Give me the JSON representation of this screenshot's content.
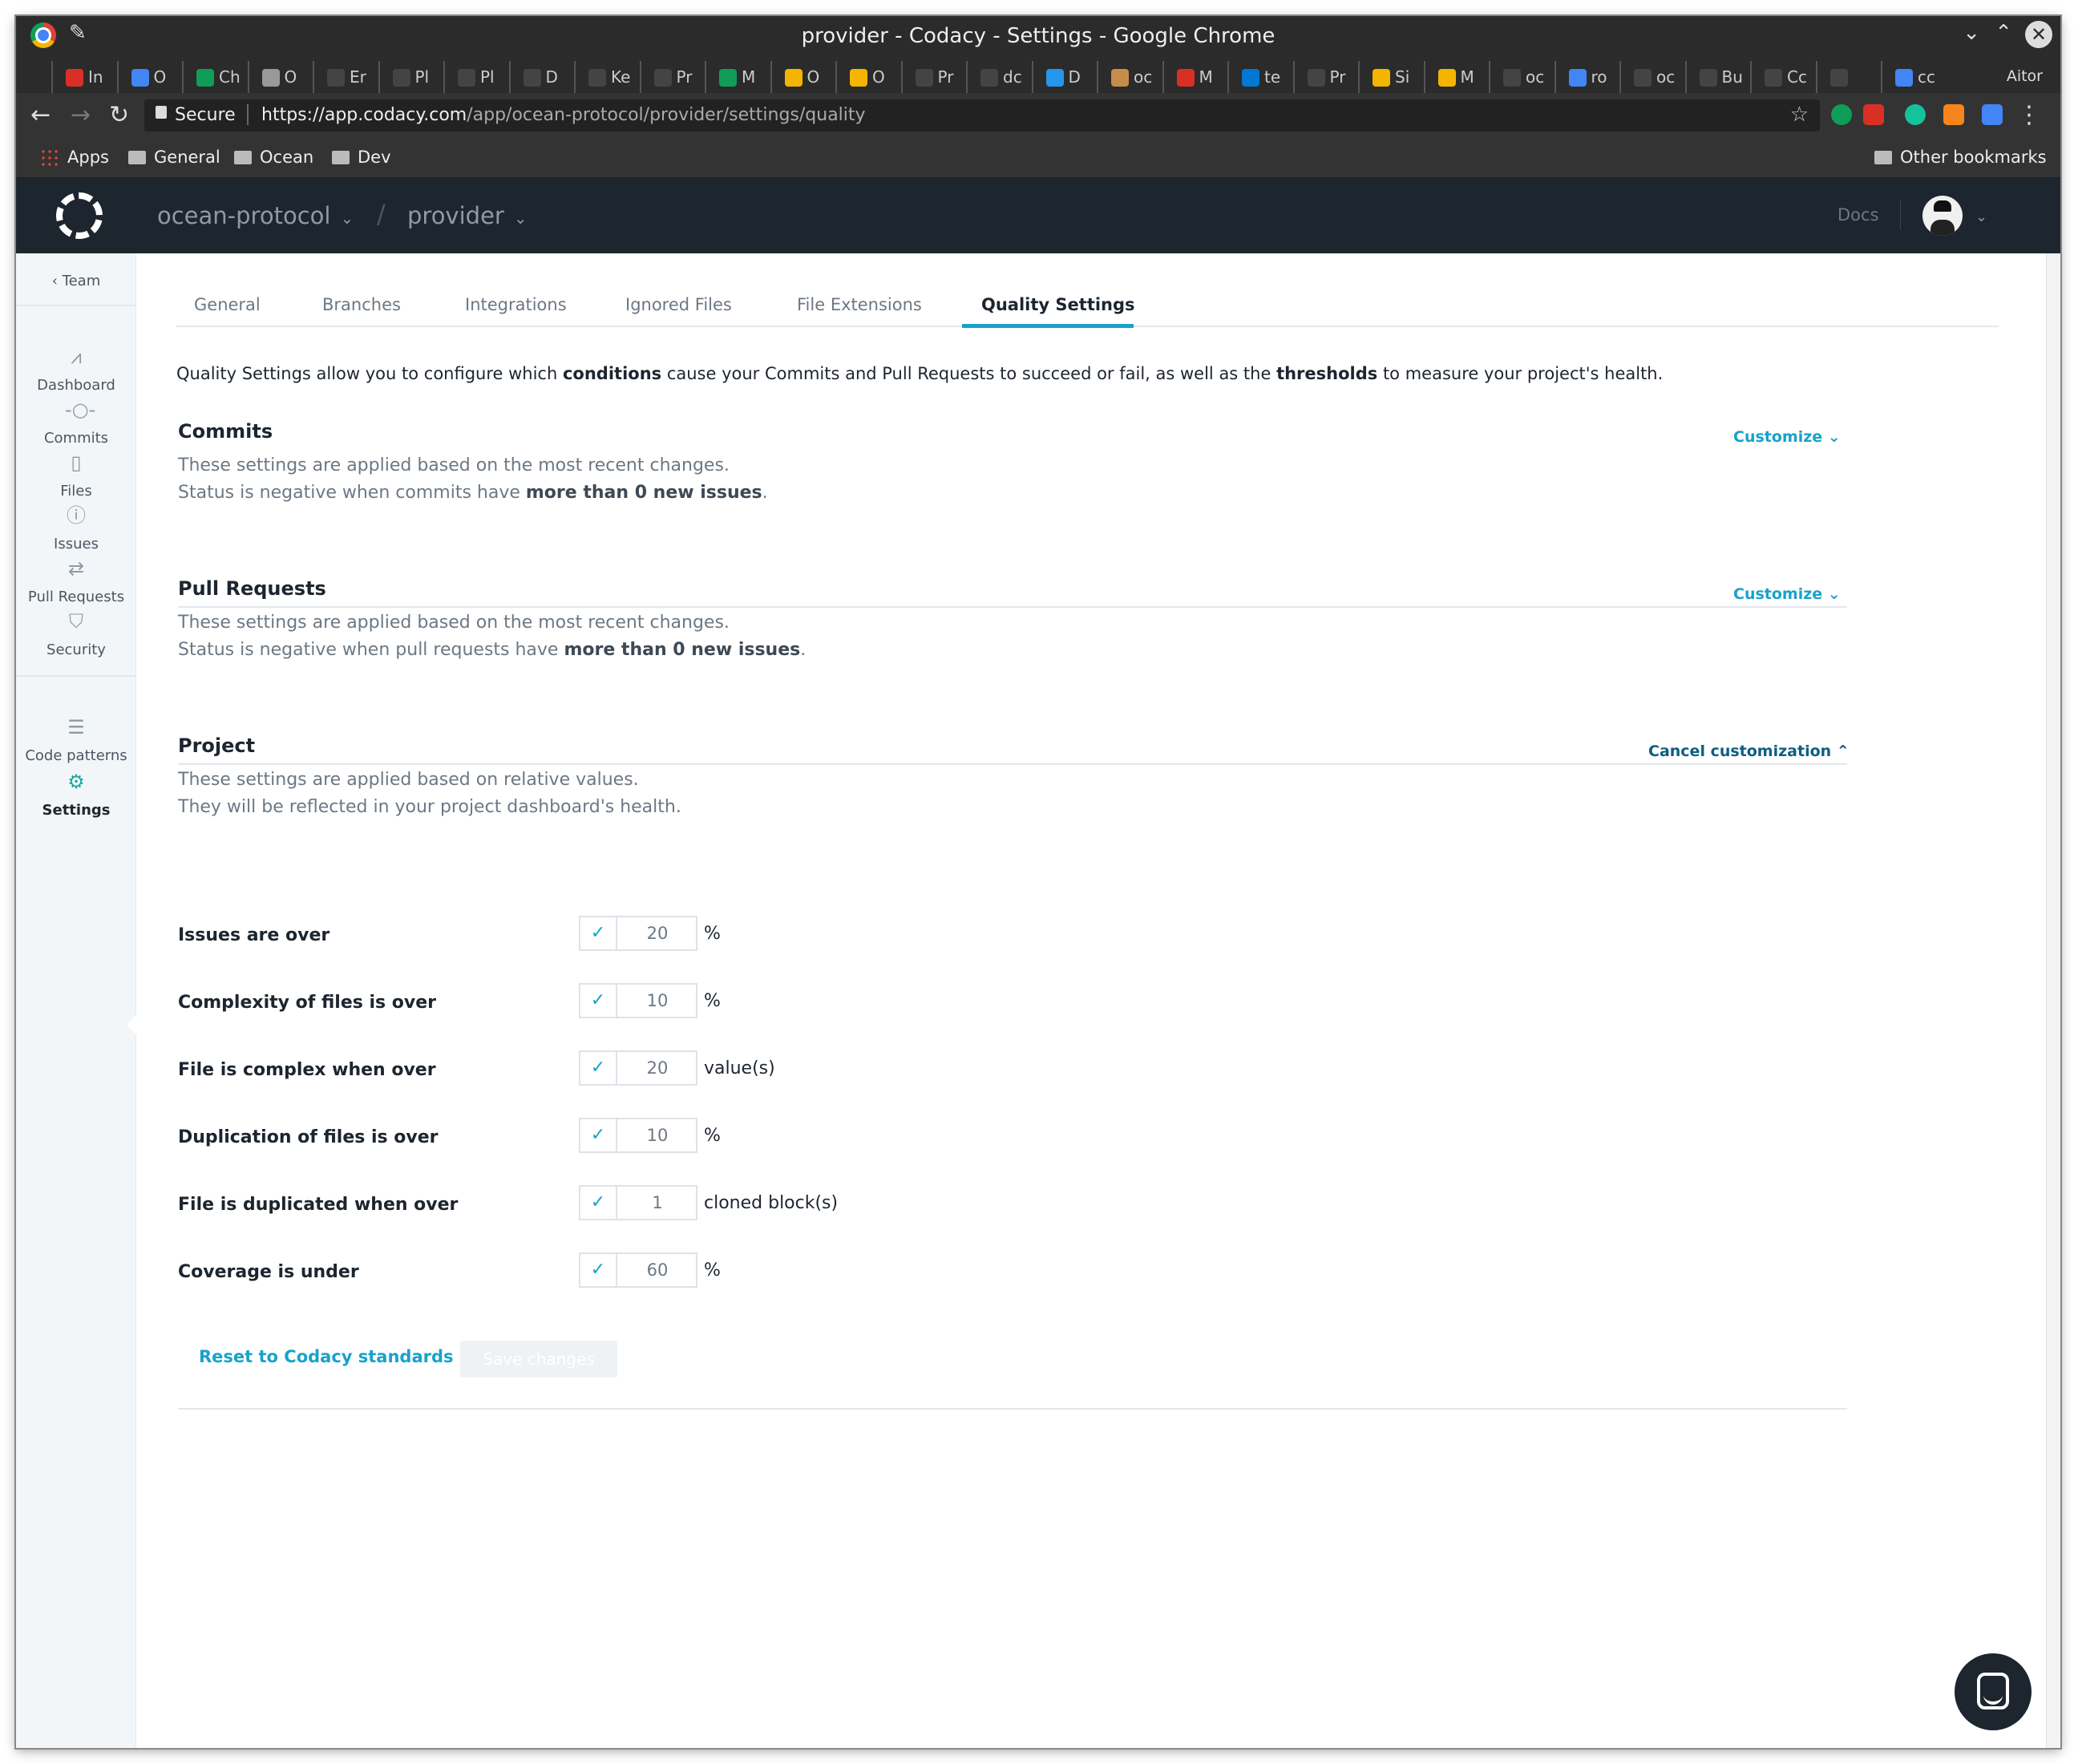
{
  "window": {
    "title": "provider - Codacy - Settings - Google Chrome",
    "user": "Aitor"
  },
  "browser_tabs": [
    {
      "label": "In",
      "icon": "gmail-icon",
      "color": "#d93025"
    },
    {
      "label": "O",
      "icon": "calendar-icon",
      "color": "#4285f4"
    },
    {
      "label": "Ch",
      "icon": "drive-icon",
      "color": "#0f9d58"
    },
    {
      "label": "O",
      "icon": "document-icon",
      "color": "#999999"
    },
    {
      "label": "Er",
      "icon": "github-icon",
      "color": "#444444"
    },
    {
      "label": "Pl",
      "icon": "github-icon",
      "color": "#444444"
    },
    {
      "label": "Pl",
      "icon": "github-icon",
      "color": "#444444"
    },
    {
      "label": "D",
      "icon": "github-icon",
      "color": "#444444"
    },
    {
      "label": "Ke",
      "icon": "github-icon",
      "color": "#444444"
    },
    {
      "label": "Pr",
      "icon": "github-icon",
      "color": "#444444"
    },
    {
      "label": "M",
      "icon": "drive-icon",
      "color": "#0f9d58"
    },
    {
      "label": "O",
      "icon": "slides-icon",
      "color": "#f4b400"
    },
    {
      "label": "O",
      "icon": "slides-icon",
      "color": "#f4b400"
    },
    {
      "label": "Pr",
      "icon": "github-icon",
      "color": "#444444"
    },
    {
      "label": "dc",
      "icon": "github-icon",
      "color": "#444444"
    },
    {
      "label": "D",
      "icon": "docker-icon",
      "color": "#2496ed"
    },
    {
      "label": "oc",
      "icon": "avatar-icon",
      "color": "#c58c4a"
    },
    {
      "label": "M",
      "icon": "app-icon",
      "color": "#d93025"
    },
    {
      "label": "te",
      "icon": "azure-icon",
      "color": "#0078d4"
    },
    {
      "label": "Pr",
      "icon": "github-icon",
      "color": "#444444"
    },
    {
      "label": "Si",
      "icon": "box-icon",
      "color": "#f4b400"
    },
    {
      "label": "M",
      "icon": "box-icon",
      "color": "#f4b400"
    },
    {
      "label": "oc",
      "icon": "github-icon",
      "color": "#444444"
    },
    {
      "label": "ro",
      "icon": "docs-icon",
      "color": "#4285f4"
    },
    {
      "label": "oc",
      "icon": "github-icon",
      "color": "#444444"
    },
    {
      "label": "Bu",
      "icon": "github-icon",
      "color": "#444444"
    },
    {
      "label": "Cc",
      "icon": "github-icon",
      "color": "#444444"
    },
    {
      "label": "",
      "icon": "github-icon",
      "color": "#444444"
    },
    {
      "label": "cc",
      "icon": "google-icon",
      "color": "#4285f4"
    }
  ],
  "address": {
    "secure_label": "Secure",
    "url_host": "https://app.codacy.com",
    "url_path": "/app/ocean-protocol/provider/settings/quality"
  },
  "bookmarks": {
    "apps": "Apps",
    "items": [
      "General",
      "Ocean",
      "Dev"
    ],
    "other": "Other bookmarks"
  },
  "header": {
    "org": "ocean-protocol",
    "repo": "provider",
    "docs": "Docs"
  },
  "sidebar": {
    "back": "Team",
    "items": [
      {
        "label": "Dashboard",
        "icon": "dashboard-icon"
      },
      {
        "label": "Commits",
        "icon": "commit-icon"
      },
      {
        "label": "Files",
        "icon": "file-icon"
      },
      {
        "label": "Issues",
        "icon": "issue-icon"
      },
      {
        "label": "Pull Requests",
        "icon": "pull-request-icon"
      },
      {
        "label": "Security",
        "icon": "shield-icon"
      },
      {
        "label": "Code patterns",
        "icon": "list-icon"
      },
      {
        "label": "Settings",
        "icon": "gear-icon"
      }
    ]
  },
  "settings_tabs": [
    "General",
    "Branches",
    "Integrations",
    "Ignored Files",
    "File Extensions",
    "Quality Settings"
  ],
  "active_tab": "Quality Settings",
  "intro": {
    "p1": "Quality Settings allow you to configure which ",
    "b1": "conditions",
    "p2": " cause your Commits and Pull Requests to succeed or fail, as well as the ",
    "b2": "thresholds",
    "p3": " to measure your project's health."
  },
  "commits": {
    "title": "Commits",
    "line1": "These settings are applied based on the most recent changes.",
    "line2_pre": "Status is negative when commits have ",
    "line2_bold": "more than 0 new issues",
    "line2_post": ".",
    "action": "Customize"
  },
  "pull_requests": {
    "title": "Pull Requests",
    "line1": "These settings are applied based on the most recent changes.",
    "line2_pre": "Status is negative when pull requests have ",
    "line2_bold": "more than 0 new issues",
    "line2_post": ".",
    "action": "Customize"
  },
  "project": {
    "title": "Project",
    "line1": "These settings are applied based on relative values.",
    "line2": "They will be reflected in your project dashboard's health.",
    "action": "Cancel customization",
    "thresholds": [
      {
        "label": "Issues are over",
        "value": "20",
        "unit": "%",
        "checked": true
      },
      {
        "label": "Complexity of files is over",
        "value": "10",
        "unit": "%",
        "checked": true
      },
      {
        "label": "File is complex when over",
        "value": "20",
        "unit": "value(s)",
        "checked": true
      },
      {
        "label": "Duplication of files is over",
        "value": "10",
        "unit": "%",
        "checked": true
      },
      {
        "label": "File is duplicated when over",
        "value": "1",
        "unit": "cloned block(s)",
        "checked": true
      },
      {
        "label": "Coverage is under",
        "value": "60",
        "unit": "%",
        "checked": true
      }
    ],
    "reset": "Reset to Codacy standards",
    "save": "Save changes"
  },
  "colors": {
    "accent": "#19a2c9",
    "header_bg": "#1d252f",
    "settings_active": "#19a99d"
  }
}
